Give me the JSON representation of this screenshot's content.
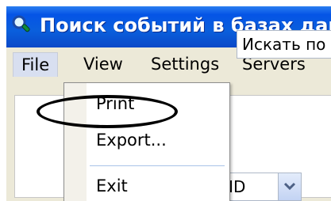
{
  "window": {
    "title": "Поиск событий в базах данн"
  },
  "menubar": {
    "items": [
      "File",
      "View",
      "Settings",
      "Servers"
    ]
  },
  "file_menu": {
    "items": [
      "Print",
      "Export...",
      "Exit"
    ]
  },
  "search": {
    "label": "Искать по т"
  },
  "combo": {
    "value": "ND"
  },
  "colors": {
    "title_bar": "#0554e6",
    "menu_bg": "#ece9d8",
    "separator": "#a9c3e8"
  }
}
